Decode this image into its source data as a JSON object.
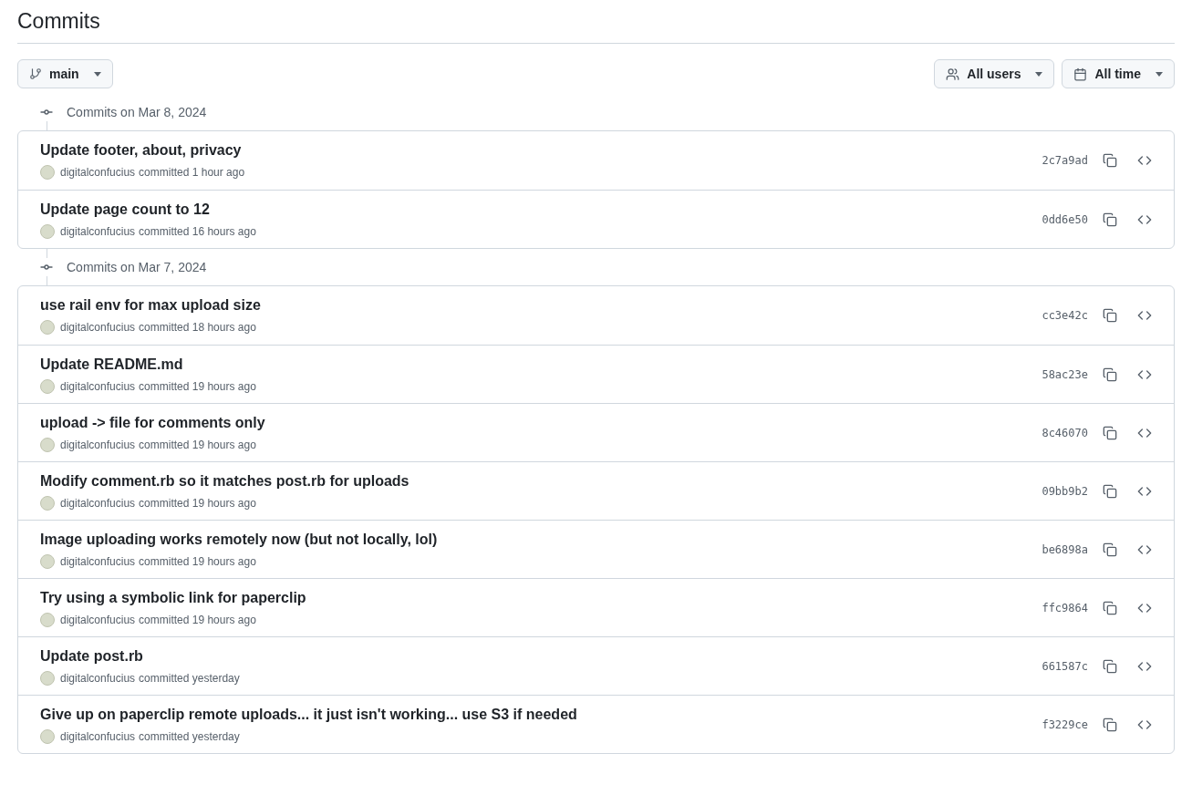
{
  "title": "Commits",
  "branch_button": {
    "label": "main"
  },
  "filters": [
    {
      "kind": "users",
      "label": "All users"
    },
    {
      "kind": "time",
      "label": "All time"
    }
  ],
  "groups": [
    {
      "heading": "Commits on Mar 8, 2024",
      "commits": [
        {
          "message": "Update footer, about, privacy",
          "author": "digitalconfucius",
          "when": "committed 1 hour ago",
          "sha": "2c7a9ad"
        },
        {
          "message": "Update page count to 12",
          "author": "digitalconfucius",
          "when": "committed 16 hours ago",
          "sha": "0dd6e50"
        }
      ]
    },
    {
      "heading": "Commits on Mar 7, 2024",
      "commits": [
        {
          "message": "use rail env for max upload size",
          "author": "digitalconfucius",
          "when": "committed 18 hours ago",
          "sha": "cc3e42c"
        },
        {
          "message": "Update README.md",
          "author": "digitalconfucius",
          "when": "committed 19 hours ago",
          "sha": "58ac23e"
        },
        {
          "message": "upload -> file for comments only",
          "author": "digitalconfucius",
          "when": "committed 19 hours ago",
          "sha": "8c46070"
        },
        {
          "message": "Modify comment.rb so it matches post.rb for uploads",
          "author": "digitalconfucius",
          "when": "committed 19 hours ago",
          "sha": "09bb9b2"
        },
        {
          "message": "Image uploading works remotely now (but not locally, lol)",
          "author": "digitalconfucius",
          "when": "committed 19 hours ago",
          "sha": "be6898a"
        },
        {
          "message": "Try using a symbolic link for paperclip",
          "author": "digitalconfucius",
          "when": "committed 19 hours ago",
          "sha": "ffc9864"
        },
        {
          "message": "Update post.rb",
          "author": "digitalconfucius",
          "when": "committed yesterday",
          "sha": "661587c"
        },
        {
          "message": "Give up on paperclip remote uploads... it just isn't working... use S3 if needed",
          "author": "digitalconfucius",
          "when": "committed yesterday",
          "sha": "f3229ce"
        }
      ]
    }
  ]
}
